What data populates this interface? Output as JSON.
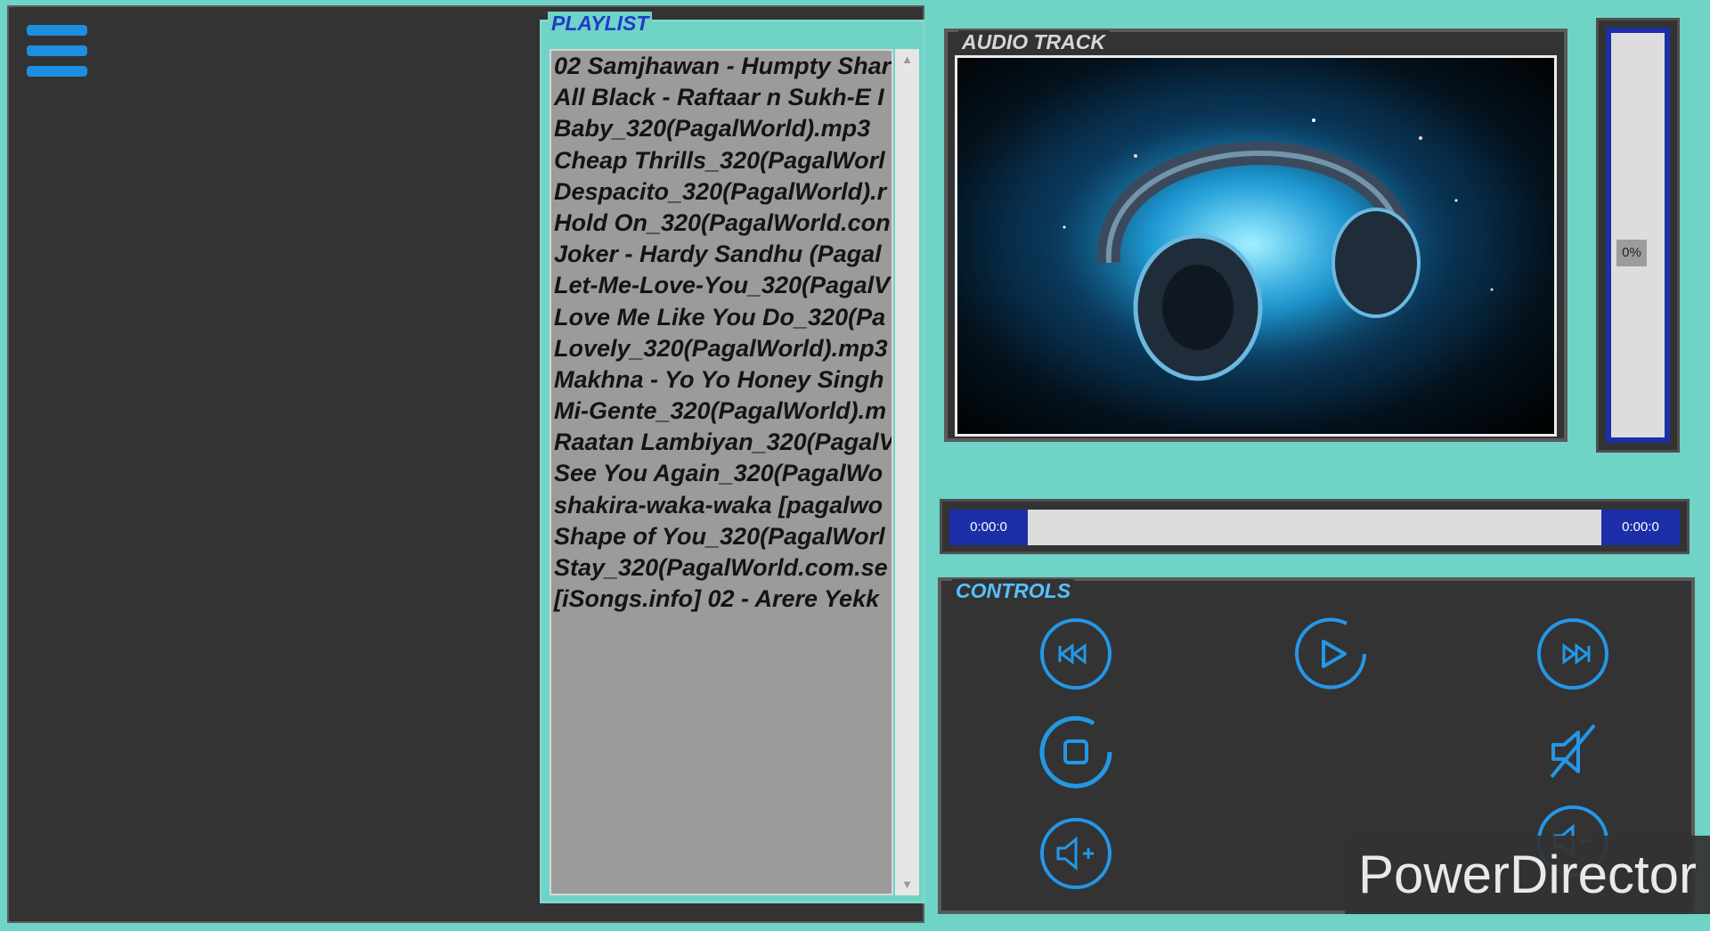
{
  "playlist": {
    "title": "PLAYLIST",
    "tracks": [
      "02 Samjhawan - Humpty Shar",
      "All Black - Raftaar n Sukh-E I",
      "Baby_320(PagalWorld).mp3",
      "Cheap Thrills_320(PagalWorl",
      "Despacito_320(PagalWorld).r",
      "Hold On_320(PagalWorld.con",
      "Joker - Hardy Sandhu (Pagal",
      "Let-Me-Love-You_320(PagalV",
      "Love Me Like You Do_320(Pa",
      "Lovely_320(PagalWorld).mp3",
      "Makhna - Yo Yo Honey Singh",
      "Mi-Gente_320(PagalWorld).m",
      "Raatan Lambiyan_320(PagalV",
      "See You Again_320(PagalWo",
      "shakira-waka-waka [pagalwo",
      "Shape of You_320(PagalWorl",
      "Stay_320(PagalWorld.com.se",
      "[iSongs.info] 02 - Arere Yekk"
    ]
  },
  "audio_track": {
    "title": "AUDIO TRACK",
    "art_icon": "headphones-artwork"
  },
  "volume_progress": {
    "label": "0%",
    "value": 0
  },
  "seek": {
    "elapsed": "0:00:0",
    "total": "0:00:0",
    "value": 0
  },
  "controls": {
    "title": "CONTROLS",
    "buttons": [
      "previous-icon",
      "play-icon",
      "next-icon",
      "stop-icon",
      "mute-icon",
      "volume-up-icon",
      "volume-down-icon"
    ]
  },
  "watermark": {
    "text": "PowerDirector"
  },
  "colors": {
    "background": "#6fd3c6",
    "panel": "#333333",
    "accent": "#1e8fe0",
    "progress": "#1c2fa8"
  }
}
